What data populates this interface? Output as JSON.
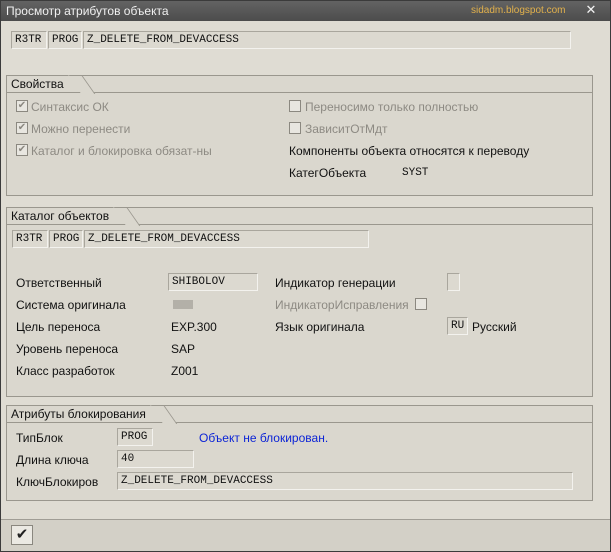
{
  "window": {
    "title": "Просмотр атрибутов объекта",
    "watermark": "sidadm.blogspot.com",
    "close_glyph": "✕"
  },
  "header": {
    "pgmid": "R3TR",
    "object_type": "PROG",
    "object_name": "Z_DELETE_FROM_DEVACCESS"
  },
  "properties": {
    "title": "Свойства",
    "syntax_ok": {
      "label": "Синтаксис ОК",
      "checked": true
    },
    "transportable": {
      "label": "Можно перенести",
      "checked": true
    },
    "catalog_lock": {
      "label": "Каталог и блокировка обязат-ны",
      "checked": true
    },
    "transport_full_only": {
      "label": "Переносимо только полностью",
      "checked": false
    },
    "depends_on_client": {
      "label": "ЗависитОтМдт",
      "checked": false
    },
    "components_translation": "Компоненты объекта относятся к переводу",
    "object_category_label": "КатегОбъекта",
    "object_category_value": "SYST"
  },
  "catalog": {
    "title": "Каталог объектов",
    "pgmid": "R3TR",
    "object_type": "PROG",
    "object_name": "Z_DELETE_FROM_DEVACCESS",
    "responsible_label": "Ответственный",
    "responsible_value": "SHIBOLOV",
    "source_system_label": "Система оригинала",
    "transport_target_label": "Цель переноса",
    "transport_target_value": "EXP.300",
    "transport_layer_label": "Уровень переноса",
    "transport_layer_value": "SAP",
    "dev_class_label": "Класс разработок",
    "dev_class_value": "Z001",
    "generation_flag_label": "Индикатор генерации",
    "correction_flag_label": "ИндикаторИсправления",
    "original_lang_label": "Язык оригинала",
    "original_lang_code": "RU",
    "original_lang_name": "Русский"
  },
  "lock": {
    "title": "Атрибуты блокирования",
    "lock_type_label": "ТипБлок",
    "lock_type_value": "PROG",
    "lock_status": "Объект не блокирован.",
    "key_length_label": "Длина ключа",
    "key_length_value": "40",
    "lock_key_label": "КлючБлокиров",
    "lock_key_value": "Z_DELETE_FROM_DEVACCESS"
  },
  "footer": {
    "ok_glyph": "✔"
  }
}
